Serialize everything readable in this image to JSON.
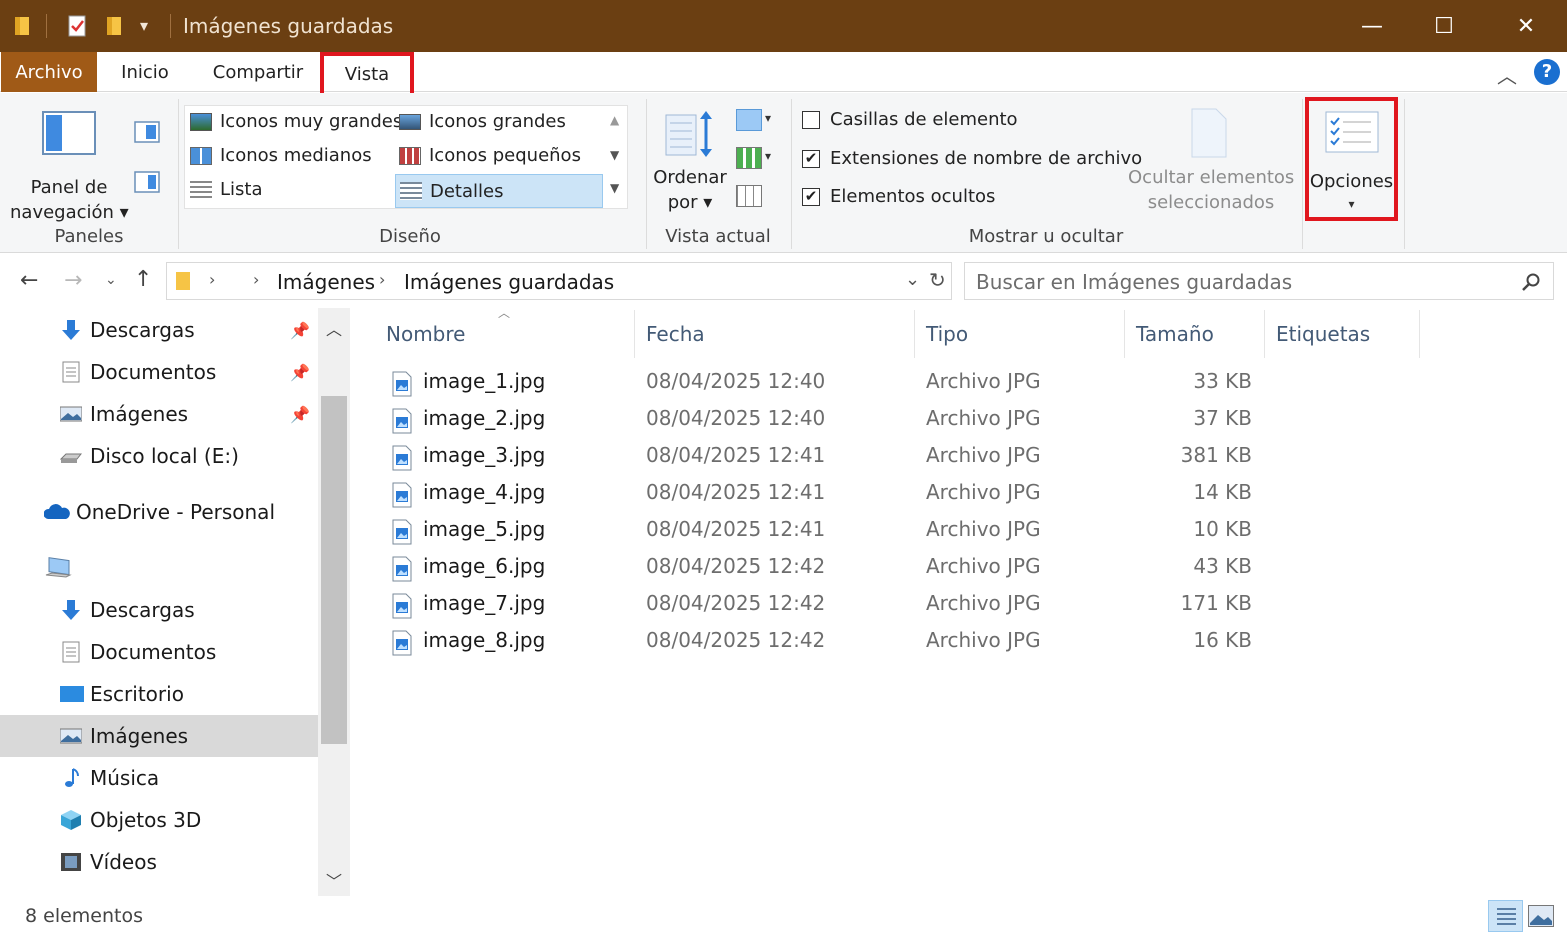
{
  "window": {
    "title": "Imágenes guardadas",
    "minimize": "—",
    "maximize": "☐",
    "close": "✕"
  },
  "tabs": {
    "file": "Archivo",
    "home": "Inicio",
    "share": "Compartir",
    "view": "Vista"
  },
  "ribbon": {
    "panes": {
      "nav_pane_line1": "Panel de",
      "nav_pane_line2": "navegación",
      "label": "Paneles"
    },
    "layout": {
      "xl_icons": "Iconos muy grandes",
      "large_icons": "Iconos grandes",
      "medium_icons": "Iconos medianos",
      "small_icons": "Iconos pequeños",
      "list": "Lista",
      "details": "Detalles",
      "label": "Diseño"
    },
    "current_view": {
      "sort_line1": "Ordenar",
      "sort_line2": "por",
      "label": "Vista actual"
    },
    "show_hide": {
      "item_checkboxes": "Casillas de elemento",
      "item_checkboxes_checked": false,
      "extensions": "Extensiones de nombre de archivo",
      "extensions_checked": true,
      "hidden_items": "Elementos ocultos",
      "hidden_items_checked": true,
      "hide_selected_line1": "Ocultar elementos",
      "hide_selected_line2": "seleccionados",
      "label": "Mostrar u ocultar"
    },
    "options": "Opciones"
  },
  "address": {
    "crumb1": "Imágenes",
    "crumb2": "Imágenes guardadas",
    "search_placeholder": "Buscar en Imágenes guardadas"
  },
  "nav": {
    "quick": [
      {
        "label": "Descargas",
        "icon": "download-icon"
      },
      {
        "label": "Documentos",
        "icon": "document-icon"
      },
      {
        "label": "Imágenes",
        "icon": "pictures-icon"
      },
      {
        "label": "Disco local (E:)",
        "icon": "drive-icon"
      }
    ],
    "onedrive": "OneDrive - Personal",
    "pc": [
      {
        "label": "Descargas",
        "icon": "download-icon"
      },
      {
        "label": "Documentos",
        "icon": "document-icon"
      },
      {
        "label": "Escritorio",
        "icon": "desktop-icon"
      },
      {
        "label": "Imágenes",
        "icon": "pictures-icon"
      },
      {
        "label": "Música",
        "icon": "music-icon"
      },
      {
        "label": "Objetos 3D",
        "icon": "cube-icon"
      },
      {
        "label": "Vídeos",
        "icon": "video-icon"
      }
    ]
  },
  "columns": {
    "name": "Nombre",
    "date": "Fecha",
    "type": "Tipo",
    "size": "Tamaño",
    "tags": "Etiquetas"
  },
  "files": [
    {
      "name": "image_1.jpg",
      "date": "08/04/2025 12:40",
      "type": "Archivo JPG",
      "size": "33 KB"
    },
    {
      "name": "image_2.jpg",
      "date": "08/04/2025 12:40",
      "type": "Archivo JPG",
      "size": "37 KB"
    },
    {
      "name": "image_3.jpg",
      "date": "08/04/2025 12:41",
      "type": "Archivo JPG",
      "size": "381 KB"
    },
    {
      "name": "image_4.jpg",
      "date": "08/04/2025 12:41",
      "type": "Archivo JPG",
      "size": "14 KB"
    },
    {
      "name": "image_5.jpg",
      "date": "08/04/2025 12:41",
      "type": "Archivo JPG",
      "size": "10 KB"
    },
    {
      "name": "image_6.jpg",
      "date": "08/04/2025 12:42",
      "type": "Archivo JPG",
      "size": "43 KB"
    },
    {
      "name": "image_7.jpg",
      "date": "08/04/2025 12:42",
      "type": "Archivo JPG",
      "size": "171 KB"
    },
    {
      "name": "image_8.jpg",
      "date": "08/04/2025 12:42",
      "type": "Archivo JPG",
      "size": "16 KB"
    }
  ],
  "status": {
    "count": "8 elementos"
  }
}
